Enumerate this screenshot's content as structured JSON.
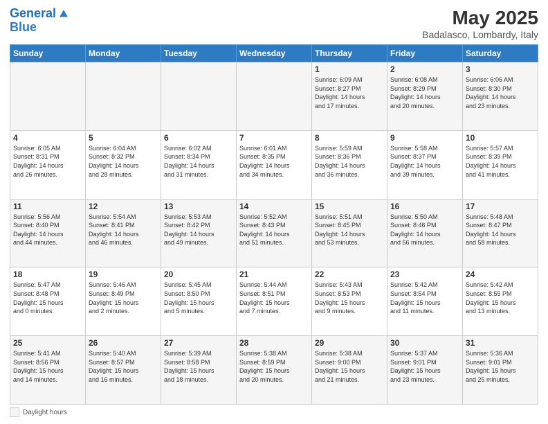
{
  "header": {
    "logo_line1": "General",
    "logo_line2": "Blue",
    "month": "May 2025",
    "location": "Badalasco, Lombardy, Italy"
  },
  "weekdays": [
    "Sunday",
    "Monday",
    "Tuesday",
    "Wednesday",
    "Thursday",
    "Friday",
    "Saturday"
  ],
  "weeks": [
    [
      {
        "num": "",
        "info": ""
      },
      {
        "num": "",
        "info": ""
      },
      {
        "num": "",
        "info": ""
      },
      {
        "num": "",
        "info": ""
      },
      {
        "num": "1",
        "info": "Sunrise: 6:09 AM\nSunset: 8:27 PM\nDaylight: 14 hours\nand 17 minutes."
      },
      {
        "num": "2",
        "info": "Sunrise: 6:08 AM\nSunset: 8:29 PM\nDaylight: 14 hours\nand 20 minutes."
      },
      {
        "num": "3",
        "info": "Sunrise: 6:06 AM\nSunset: 8:30 PM\nDaylight: 14 hours\nand 23 minutes."
      }
    ],
    [
      {
        "num": "4",
        "info": "Sunrise: 6:05 AM\nSunset: 8:31 PM\nDaylight: 14 hours\nand 26 minutes."
      },
      {
        "num": "5",
        "info": "Sunrise: 6:04 AM\nSunset: 8:32 PM\nDaylight: 14 hours\nand 28 minutes."
      },
      {
        "num": "6",
        "info": "Sunrise: 6:02 AM\nSunset: 8:34 PM\nDaylight: 14 hours\nand 31 minutes."
      },
      {
        "num": "7",
        "info": "Sunrise: 6:01 AM\nSunset: 8:35 PM\nDaylight: 14 hours\nand 34 minutes."
      },
      {
        "num": "8",
        "info": "Sunrise: 5:59 AM\nSunset: 8:36 PM\nDaylight: 14 hours\nand 36 minutes."
      },
      {
        "num": "9",
        "info": "Sunrise: 5:58 AM\nSunset: 8:37 PM\nDaylight: 14 hours\nand 39 minutes."
      },
      {
        "num": "10",
        "info": "Sunrise: 5:57 AM\nSunset: 8:39 PM\nDaylight: 14 hours\nand 41 minutes."
      }
    ],
    [
      {
        "num": "11",
        "info": "Sunrise: 5:56 AM\nSunset: 8:40 PM\nDaylight: 14 hours\nand 44 minutes."
      },
      {
        "num": "12",
        "info": "Sunrise: 5:54 AM\nSunset: 8:41 PM\nDaylight: 14 hours\nand 46 minutes."
      },
      {
        "num": "13",
        "info": "Sunrise: 5:53 AM\nSunset: 8:42 PM\nDaylight: 14 hours\nand 49 minutes."
      },
      {
        "num": "14",
        "info": "Sunrise: 5:52 AM\nSunset: 8:43 PM\nDaylight: 14 hours\nand 51 minutes."
      },
      {
        "num": "15",
        "info": "Sunrise: 5:51 AM\nSunset: 8:45 PM\nDaylight: 14 hours\nand 53 minutes."
      },
      {
        "num": "16",
        "info": "Sunrise: 5:50 AM\nSunset: 8:46 PM\nDaylight: 14 hours\nand 56 minutes."
      },
      {
        "num": "17",
        "info": "Sunrise: 5:48 AM\nSunset: 8:47 PM\nDaylight: 14 hours\nand 58 minutes."
      }
    ],
    [
      {
        "num": "18",
        "info": "Sunrise: 5:47 AM\nSunset: 8:48 PM\nDaylight: 15 hours\nand 0 minutes."
      },
      {
        "num": "19",
        "info": "Sunrise: 5:46 AM\nSunset: 8:49 PM\nDaylight: 15 hours\nand 2 minutes."
      },
      {
        "num": "20",
        "info": "Sunrise: 5:45 AM\nSunset: 8:50 PM\nDaylight: 15 hours\nand 5 minutes."
      },
      {
        "num": "21",
        "info": "Sunrise: 5:44 AM\nSunset: 8:51 PM\nDaylight: 15 hours\nand 7 minutes."
      },
      {
        "num": "22",
        "info": "Sunrise: 5:43 AM\nSunset: 8:53 PM\nDaylight: 15 hours\nand 9 minutes."
      },
      {
        "num": "23",
        "info": "Sunrise: 5:42 AM\nSunset: 8:54 PM\nDaylight: 15 hours\nand 11 minutes."
      },
      {
        "num": "24",
        "info": "Sunrise: 5:42 AM\nSunset: 8:55 PM\nDaylight: 15 hours\nand 13 minutes."
      }
    ],
    [
      {
        "num": "25",
        "info": "Sunrise: 5:41 AM\nSunset: 8:56 PM\nDaylight: 15 hours\nand 14 minutes."
      },
      {
        "num": "26",
        "info": "Sunrise: 5:40 AM\nSunset: 8:57 PM\nDaylight: 15 hours\nand 16 minutes."
      },
      {
        "num": "27",
        "info": "Sunrise: 5:39 AM\nSunset: 8:58 PM\nDaylight: 15 hours\nand 18 minutes."
      },
      {
        "num": "28",
        "info": "Sunrise: 5:38 AM\nSunset: 8:59 PM\nDaylight: 15 hours\nand 20 minutes."
      },
      {
        "num": "29",
        "info": "Sunrise: 5:38 AM\nSunset: 9:00 PM\nDaylight: 15 hours\nand 21 minutes."
      },
      {
        "num": "30",
        "info": "Sunrise: 5:37 AM\nSunset: 9:01 PM\nDaylight: 15 hours\nand 23 minutes."
      },
      {
        "num": "31",
        "info": "Sunrise: 5:36 AM\nSunset: 9:01 PM\nDaylight: 15 hours\nand 25 minutes."
      }
    ]
  ],
  "legend": {
    "label": "Daylight hours"
  }
}
